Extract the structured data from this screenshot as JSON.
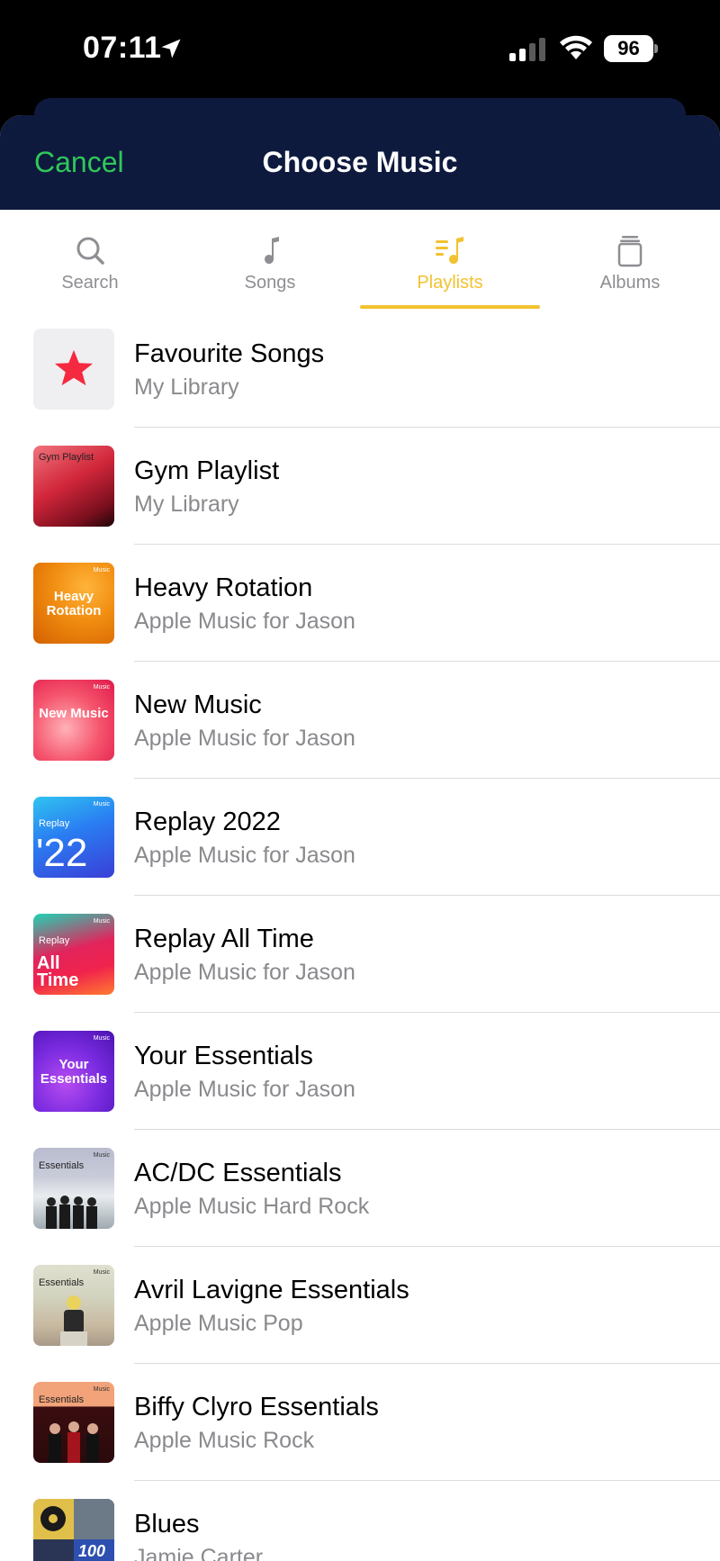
{
  "status": {
    "time": "07:11",
    "battery": "96"
  },
  "header": {
    "cancel_label": "Cancel",
    "title": "Choose Music"
  },
  "tabs": [
    {
      "label": "Search",
      "icon": "search-icon"
    },
    {
      "label": "Songs",
      "icon": "music-note-icon"
    },
    {
      "label": "Playlists",
      "icon": "playlist-icon",
      "active": true
    },
    {
      "label": "Albums",
      "icon": "albums-icon"
    }
  ],
  "colors": {
    "accent": "#f2c230",
    "cancel": "#30c759",
    "header_bg": "#0e1a3d"
  },
  "playlists": [
    {
      "title": "Favourite Songs",
      "subtitle": "My Library",
      "art_label": ""
    },
    {
      "title": "Gym Playlist",
      "subtitle": "My Library",
      "art_label": "Gym Playlist"
    },
    {
      "title": "Heavy Rotation",
      "subtitle": "Apple Music for Jason",
      "art_label": "Heavy Rotation"
    },
    {
      "title": "New Music",
      "subtitle": "Apple Music for Jason",
      "art_label": "New Music"
    },
    {
      "title": "Replay 2022",
      "subtitle": "Apple Music for Jason",
      "art_label": "Replay",
      "art_big": "'22"
    },
    {
      "title": "Replay All Time",
      "subtitle": "Apple Music for Jason",
      "art_label": "Replay",
      "art_big": "All Time"
    },
    {
      "title": "Your Essentials",
      "subtitle": "Apple Music for Jason",
      "art_label": "Your Essentials"
    },
    {
      "title": "AC/DC Essentials",
      "subtitle": "Apple Music Hard Rock",
      "art_label": "Essentials"
    },
    {
      "title": "Avril Lavigne Essentials",
      "subtitle": "Apple Music Pop",
      "art_label": "Essentials"
    },
    {
      "title": "Biffy Clyro Essentials",
      "subtitle": "Apple Music Rock",
      "art_label": "Essentials"
    },
    {
      "title": "Blues",
      "subtitle": "Jamie Carter",
      "art_label": "100"
    }
  ],
  "art_badge": "Music"
}
